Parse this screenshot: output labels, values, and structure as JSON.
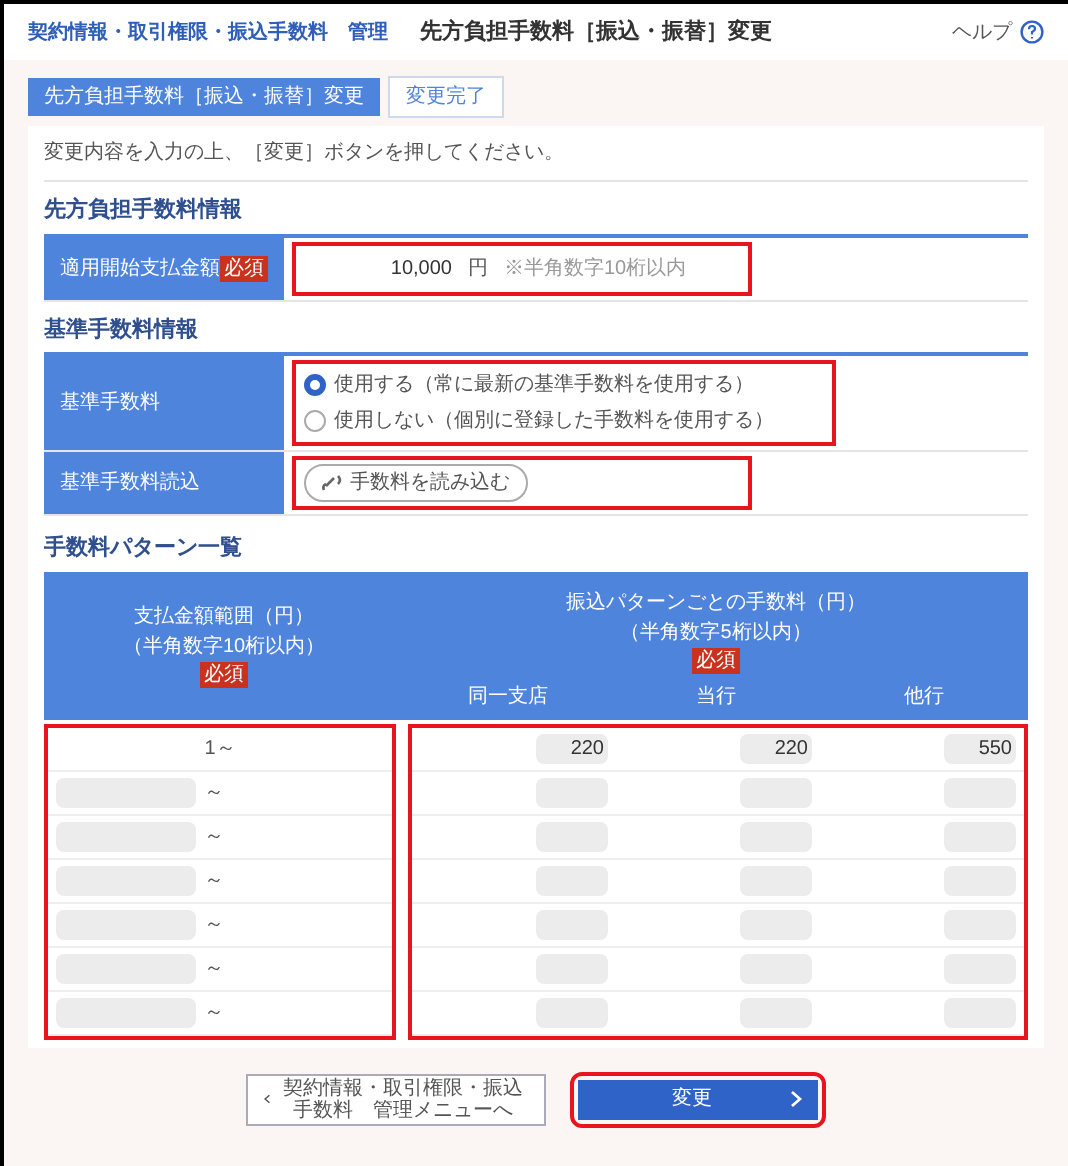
{
  "header": {
    "breadcrumb": "契約情報・取引権限・振込手数料　管理",
    "title": "先方負担手数料［振込・振替］変更",
    "help": "ヘルプ"
  },
  "steps": [
    {
      "label": "先方負担手数料［振込・振替］変更",
      "selected": true
    },
    {
      "label": "変更完了",
      "selected": false
    }
  ],
  "instruction": "変更内容を入力の上、［変更］ボタンを押してください。",
  "sections": [
    {
      "title": "先方負担手数料情報",
      "rows": [
        {
          "kind": "amount",
          "label": "適用開始支払金額",
          "required": "必須",
          "value": "10,000",
          "unit": "円",
          "note": "※半角数字10桁以内"
        }
      ]
    },
    {
      "title": "基準手数料情報",
      "rows": [
        {
          "kind": "radio",
          "label": "基準手数料",
          "options": [
            {
              "label": "使用する（常に最新の基準手数料を使用する）",
              "selected": true
            },
            {
              "label": "使用しない（個別に登録した手数料を使用する）",
              "selected": false
            }
          ]
        },
        {
          "kind": "button",
          "label": "基準手数料読込",
          "button": "手数料を読み込む"
        }
      ]
    }
  ],
  "fee_table": {
    "title": "手数料パターン一覧",
    "amount_header": "支払金額範囲（円）",
    "amount_note": "（半角数字10桁以内）",
    "amount_required": "必須",
    "fee_header": "振込パターンごとの手数料（円）",
    "fee_note": "（半角数字5桁以内）",
    "fee_required": "必須",
    "columns": [
      "同一支店",
      "当行",
      "他行"
    ],
    "rows": [
      {
        "kind": "fixed",
        "from": "1",
        "sep": "～",
        "fees": [
          "220",
          "220",
          "550"
        ]
      },
      {
        "kind": "input",
        "sep": "～"
      },
      {
        "kind": "input",
        "sep": "～"
      },
      {
        "kind": "input",
        "sep": "～"
      },
      {
        "kind": "input",
        "sep": "～"
      },
      {
        "kind": "input",
        "sep": "～"
      },
      {
        "kind": "input",
        "sep": "～"
      }
    ]
  },
  "buttons": {
    "back": "契約情報・取引権限・振込手数料　管理メニューへ",
    "submit": "変更"
  }
}
